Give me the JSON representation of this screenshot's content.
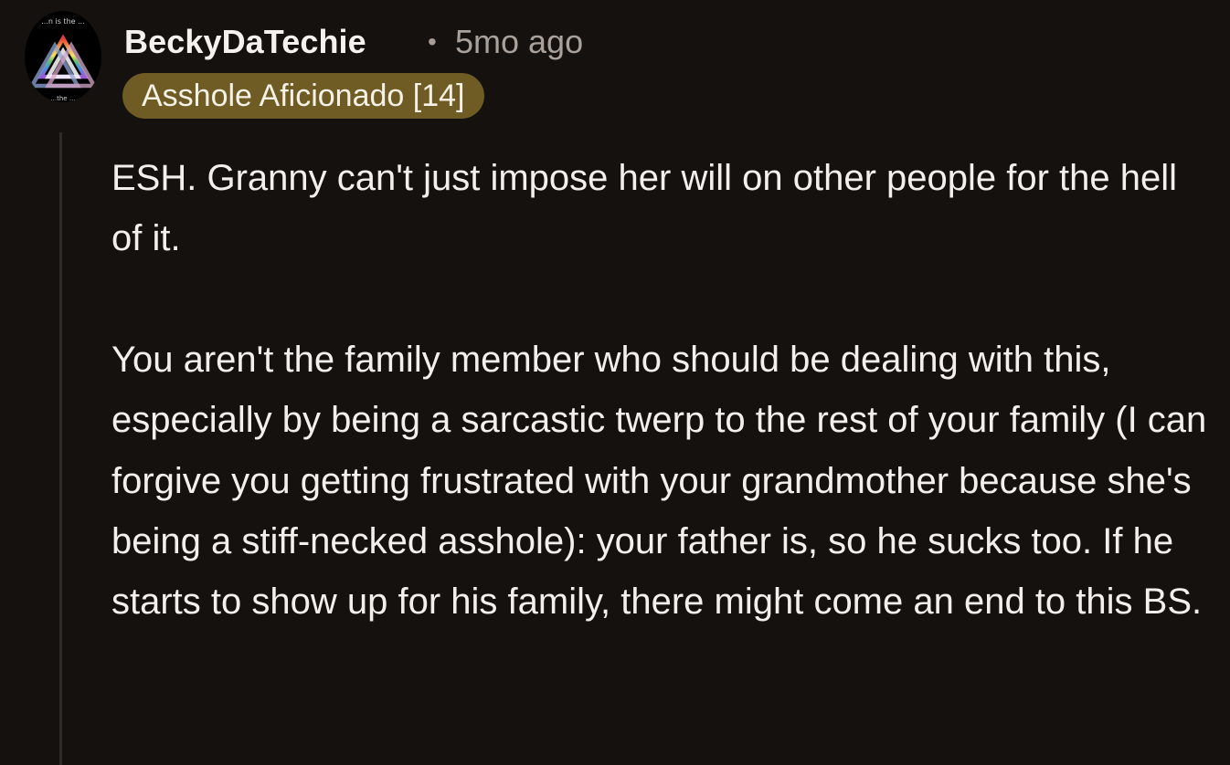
{
  "comment": {
    "author": "BeckyDaTechie",
    "separator": "•",
    "age": "5mo ago",
    "flair": "Asshole Aficionado [14]",
    "avatar": {
      "icon": "valknut-pride-icon",
      "top_text": "...n is the ...",
      "bottom_text": "...the ..."
    },
    "paragraphs": [
      "ESH. Granny can't just impose her will on other people for the hell of it.",
      "You aren't the family member who should be dealing with this, especially by being a sarcastic twerp to the rest of your family (I can forgive you getting frustrated with your grandmother because she's being a stiff-necked asshole): your father is, so he sucks too. If he starts to show up for his family, there might come an end to this BS."
    ]
  },
  "colors": {
    "background": "#15110f",
    "text": "#f2efec",
    "meta": "#a9a19a",
    "flair_bg": "#6e5c24",
    "thread_line": "#2f2b29"
  }
}
